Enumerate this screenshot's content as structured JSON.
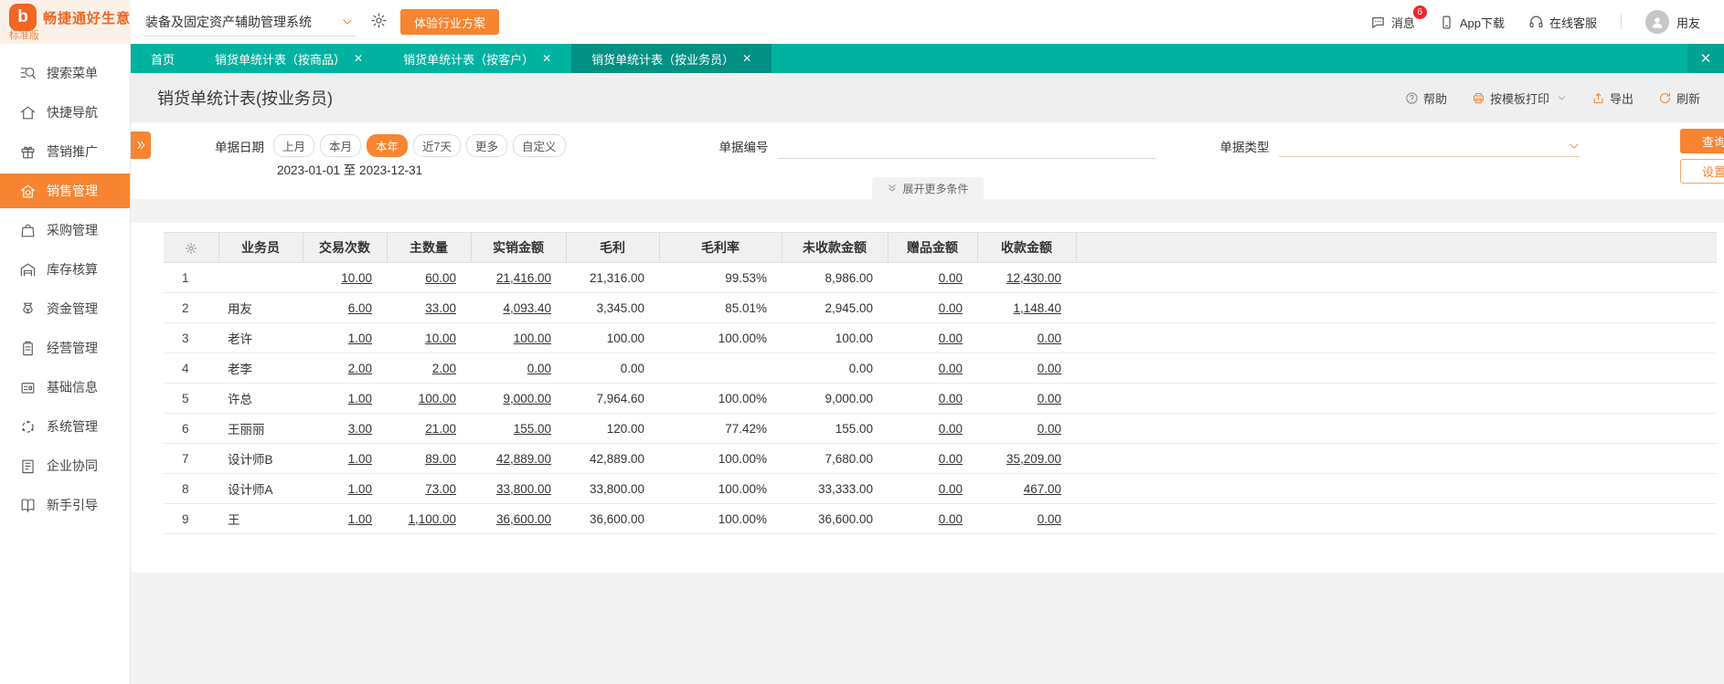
{
  "colors": {
    "accent": "#f78431",
    "logo_orange": "#f26522",
    "teal": "#00b3a0",
    "teal_active": "#009084",
    "badge_red": "#f5222d"
  },
  "topbar": {
    "brand": {
      "mark": "b",
      "title": "畅捷通好生意",
      "edition": "标准版"
    },
    "system_select": {
      "value": "装备及固定资产辅助管理系统"
    },
    "try_button": "体验行业方案",
    "messages": {
      "label": "消息",
      "badge": "6"
    },
    "app_download": "App下载",
    "support": "在线客服",
    "user": "用友"
  },
  "sidebar": {
    "items": [
      {
        "icon": "search",
        "label": "搜索菜单",
        "active": false
      },
      {
        "icon": "home",
        "label": "快捷导航",
        "active": false
      },
      {
        "icon": "gift",
        "label": "营销推广",
        "active": false
      },
      {
        "icon": "sale",
        "label": "销售管理",
        "active": true
      },
      {
        "icon": "bag",
        "label": "采购管理",
        "active": false
      },
      {
        "icon": "warehouse",
        "label": "库存核算",
        "active": false
      },
      {
        "icon": "money",
        "label": "资金管理",
        "active": false
      },
      {
        "icon": "clipboard",
        "label": "经营管理",
        "active": false
      },
      {
        "icon": "idcard",
        "label": "基础信息",
        "active": false
      },
      {
        "icon": "system",
        "label": "系统管理",
        "active": false
      },
      {
        "icon": "collab",
        "label": "企业协同",
        "active": false
      },
      {
        "icon": "guide",
        "label": "新手引导",
        "active": false
      }
    ]
  },
  "tabs": {
    "items": [
      {
        "label": "首页",
        "closable": false,
        "active": false
      },
      {
        "label": "销货单统计表（按商品）",
        "closable": true,
        "active": false
      },
      {
        "label": "销货单统计表（按客户）",
        "closable": true,
        "active": false
      },
      {
        "label": "销货单统计表（按业务员）",
        "closable": true,
        "active": true
      }
    ]
  },
  "page": {
    "title": "销货单统计表(按业务员)",
    "toolbar": {
      "help": "帮助",
      "print": "按模板打印",
      "export": "导出",
      "refresh": "刷新"
    }
  },
  "filters": {
    "date_label": "单据日期",
    "date_options": [
      "上月",
      "本月",
      "本年",
      "近7天",
      "更多",
      "自定义"
    ],
    "date_selected": "本年",
    "date_range": "2023-01-01 至 2023-12-31",
    "doc_no_label": "单据编号",
    "doc_type_label": "单据类型",
    "query_button": "查询",
    "settings_button": "设置",
    "expand_more": "展开更多条件"
  },
  "table": {
    "columns": [
      "业务员",
      "交易次数",
      "主数量",
      "实销金额",
      "毛利",
      "毛利率",
      "未收款金额",
      "赠品金额",
      "收款金额"
    ],
    "rows": [
      {
        "no": "1",
        "name": "",
        "trades": "10.00",
        "qty": "60.00",
        "sales": "21,416.00",
        "profit": "21,316.00",
        "margin": "99.53%",
        "unpaid": "8,986.00",
        "gift": "0.00",
        "received": "12,430.00"
      },
      {
        "no": "2",
        "name": "用友",
        "trades": "6.00",
        "qty": "33.00",
        "sales": "4,093.40",
        "profit": "3,345.00",
        "margin": "85.01%",
        "unpaid": "2,945.00",
        "gift": "0.00",
        "received": "1,148.40"
      },
      {
        "no": "3",
        "name": "老许",
        "trades": "1.00",
        "qty": "10.00",
        "sales": "100.00",
        "profit": "100.00",
        "margin": "100.00%",
        "unpaid": "100.00",
        "gift": "0.00",
        "received": "0.00"
      },
      {
        "no": "4",
        "name": "老李",
        "trades": "2.00",
        "qty": "2.00",
        "sales": "0.00",
        "profit": "0.00",
        "margin": "",
        "unpaid": "0.00",
        "gift": "0.00",
        "received": "0.00"
      },
      {
        "no": "5",
        "name": "许总",
        "trades": "1.00",
        "qty": "100.00",
        "sales": "9,000.00",
        "profit": "7,964.60",
        "margin": "100.00%",
        "unpaid": "9,000.00",
        "gift": "0.00",
        "received": "0.00"
      },
      {
        "no": "6",
        "name": "王丽丽",
        "trades": "3.00",
        "qty": "21.00",
        "sales": "155.00",
        "profit": "120.00",
        "margin": "77.42%",
        "unpaid": "155.00",
        "gift": "0.00",
        "received": "0.00"
      },
      {
        "no": "7",
        "name": "设计师B",
        "trades": "1.00",
        "qty": "89.00",
        "sales": "42,889.00",
        "profit": "42,889.00",
        "margin": "100.00%",
        "unpaid": "7,680.00",
        "gift": "0.00",
        "received": "35,209.00"
      },
      {
        "no": "8",
        "name": "设计师A",
        "trades": "1.00",
        "qty": "73.00",
        "sales": "33,800.00",
        "profit": "33,800.00",
        "margin": "100.00%",
        "unpaid": "33,333.00",
        "gift": "0.00",
        "received": "467.00"
      },
      {
        "no": "9",
        "name": "王",
        "trades": "1.00",
        "qty": "1,100.00",
        "sales": "36,600.00",
        "profit": "36,600.00",
        "margin": "100.00%",
        "unpaid": "36,600.00",
        "gift": "0.00",
        "received": "0.00"
      }
    ]
  }
}
